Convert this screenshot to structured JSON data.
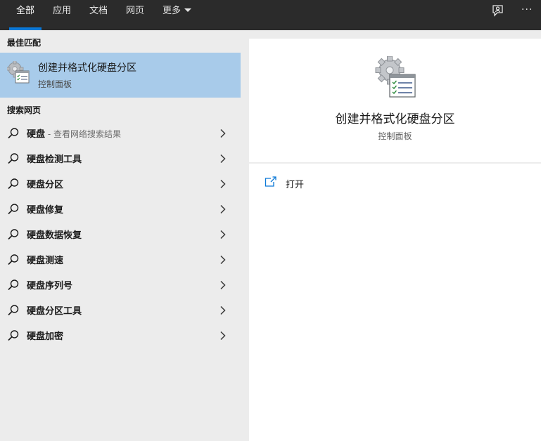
{
  "tabs": [
    {
      "label": "全部",
      "active": true
    },
    {
      "label": "应用"
    },
    {
      "label": "文档"
    },
    {
      "label": "网页"
    },
    {
      "label": "更多"
    }
  ],
  "toolbar": {
    "feedback_icon": "feedback-icon",
    "more_icon": "ellipsis-icon",
    "more_glyph": "···"
  },
  "best_match": {
    "heading": "最佳匹配",
    "title": "创建并格式化硬盘分区",
    "subtitle": "控制面板",
    "icon": "control-panel-admin-icon"
  },
  "web_search": {
    "heading": "搜索网页",
    "items": [
      {
        "label": "硬盘",
        "hint": " - 查看网络搜索结果"
      },
      {
        "label": "硬盘检测工具"
      },
      {
        "label": "硬盘分区"
      },
      {
        "label": "硬盘修复"
      },
      {
        "label": "硬盘数据恢复"
      },
      {
        "label": "硬盘测速"
      },
      {
        "label": "硬盘序列号"
      },
      {
        "label": "硬盘分区工具"
      },
      {
        "label": "硬盘加密"
      }
    ]
  },
  "detail": {
    "title": "创建并格式化硬盘分区",
    "subtitle": "控制面板",
    "actions": [
      {
        "label": "打开",
        "icon": "open-icon"
      }
    ]
  },
  "colors": {
    "topbar": "#2b2b2b",
    "accent": "#0a78d7",
    "selection": "#a8cbea",
    "left_bg": "#ececec",
    "right_bg": "#ffffff"
  }
}
